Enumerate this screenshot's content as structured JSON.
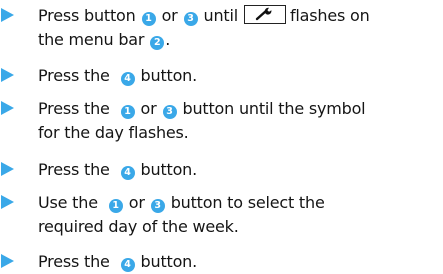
{
  "steps": [
    {
      "parts": [
        "Press button",
        "1",
        "or",
        "3",
        "until",
        "flashes on"
      ],
      "line2": "the menu bar",
      "badge2": "2",
      "line2_end": "."
    },
    {
      "pre": "Press the",
      "badge": "4",
      "post": "button."
    },
    {
      "pre": "Press the",
      "badge_a": "1",
      "mid": "or",
      "badge_b": "3",
      "post": "button until the symbol",
      "line2": "for the day flashes."
    },
    {
      "pre": "Press the",
      "badge": "4",
      "post": "button."
    },
    {
      "pre": "Use the",
      "badge_a": "1",
      "mid": "or",
      "badge_b": "3",
      "post": "button to select the",
      "line2": "required day of the week."
    },
    {
      "pre": "Press the",
      "badge": "4",
      "post": "button."
    }
  ],
  "icons": {
    "arrow": "triangle-bullet-icon",
    "wrench": "wrench-icon"
  },
  "colors": {
    "accent": "#3aa8e8",
    "text": "#151515"
  }
}
